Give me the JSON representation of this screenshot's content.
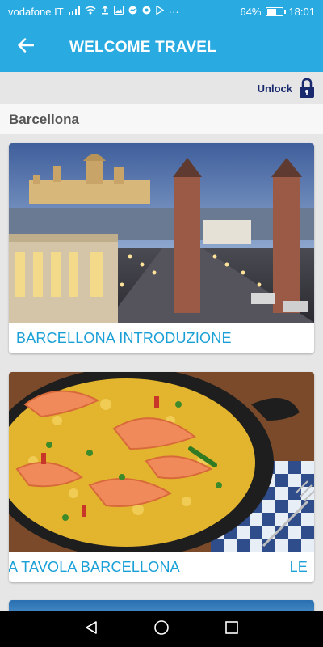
{
  "statusbar": {
    "carrier": "vodafone IT",
    "battery_percent": "64%",
    "battery_level": 0.64,
    "time": "18:01",
    "more": "···"
  },
  "appbar": {
    "title": "WELCOME TRAVEL"
  },
  "unlock": {
    "label": "Unlock"
  },
  "section": {
    "title": "Barcellona"
  },
  "cards": [
    {
      "label": "BARCELLONA INTRODUZIONE"
    },
    {
      "label": "A TAVOLA BARCELLONA",
      "next_peek": "LE"
    }
  ],
  "colors": {
    "primary": "#29abe2",
    "accent_text": "#1aa0d6",
    "unlock": "#1a2a6e"
  }
}
